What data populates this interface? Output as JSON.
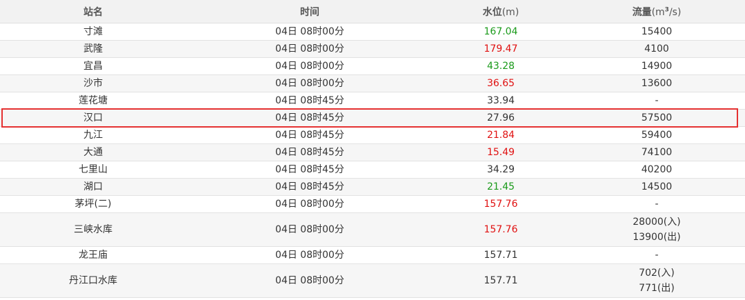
{
  "headers": {
    "station": "站名",
    "time": "时间",
    "level_label": "水位",
    "level_unit": "(m)",
    "flow_label": "流量",
    "flow_unit_pre": "(m",
    "flow_unit_sup": "3",
    "flow_unit_post": "/s)"
  },
  "highlight_color": "#e53030",
  "level_colors": {
    "green": "#1a9a1a",
    "red": "#e01010",
    "normal": "#333333"
  },
  "rows": [
    {
      "station": "寸滩",
      "time": "04日 08时00分",
      "level": "167.04",
      "level_color": "green",
      "flow": [
        "15400"
      ]
    },
    {
      "station": "武隆",
      "time": "04日 08时00分",
      "level": "179.47",
      "level_color": "red",
      "flow": [
        "4100"
      ]
    },
    {
      "station": "宜昌",
      "time": "04日 08时00分",
      "level": "43.28",
      "level_color": "green",
      "flow": [
        "14900"
      ]
    },
    {
      "station": "沙市",
      "time": "04日 08时00分",
      "level": "36.65",
      "level_color": "red",
      "flow": [
        "13600"
      ]
    },
    {
      "station": "莲花塘",
      "time": "04日 08时45分",
      "level": "33.94",
      "level_color": "normal",
      "flow": [
        "-"
      ]
    },
    {
      "station": "汉口",
      "time": "04日 08时45分",
      "level": "27.96",
      "level_color": "normal",
      "flow": [
        "57500"
      ],
      "highlighted": true
    },
    {
      "station": "九江",
      "time": "04日 08时45分",
      "level": "21.84",
      "level_color": "red",
      "flow": [
        "59400"
      ]
    },
    {
      "station": "大通",
      "time": "04日 08时45分",
      "level": "15.49",
      "level_color": "red",
      "flow": [
        "74100"
      ]
    },
    {
      "station": "七里山",
      "time": "04日 08时45分",
      "level": "34.29",
      "level_color": "normal",
      "flow": [
        "40200"
      ]
    },
    {
      "station": "湖口",
      "time": "04日 08时45分",
      "level": "21.45",
      "level_color": "green",
      "flow": [
        "14500"
      ]
    },
    {
      "station": "茅坪(二)",
      "time": "04日 08时00分",
      "level": "157.76",
      "level_color": "red",
      "flow": [
        "-"
      ]
    },
    {
      "station": "三峡水库",
      "time": "04日 08时00分",
      "level": "157.76",
      "level_color": "red",
      "flow": [
        "28000(入)",
        "13900(出)"
      ]
    },
    {
      "station": "龙王庙",
      "time": "04日 08时00分",
      "level": "157.71",
      "level_color": "normal",
      "flow": [
        "-"
      ]
    },
    {
      "station": "丹江口水库",
      "time": "04日 08时00分",
      "level": "157.71",
      "level_color": "normal",
      "flow": [
        "702(入)",
        "771(出)"
      ]
    }
  ]
}
